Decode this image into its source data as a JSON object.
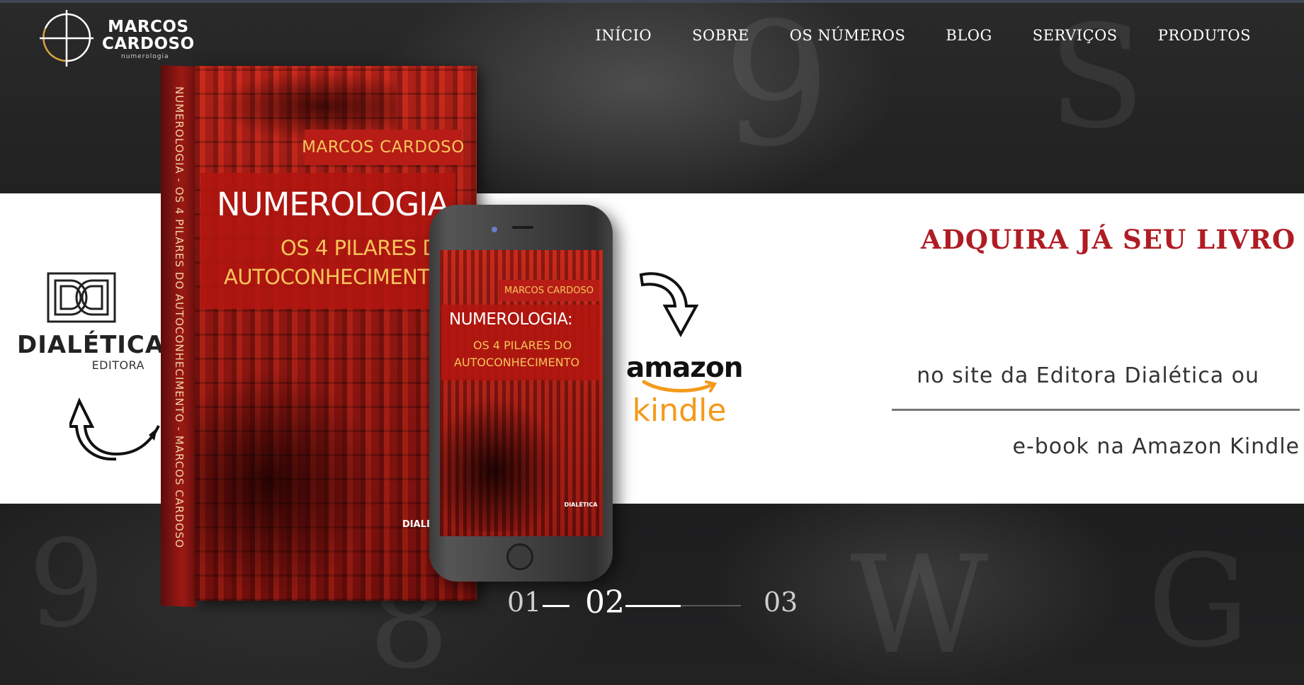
{
  "brand": {
    "name_line1": "MARCOS",
    "name_line2": "CARDOSO",
    "tagline": "numerologia"
  },
  "nav": [
    {
      "label": "INÍCIO"
    },
    {
      "label": "SOBRE"
    },
    {
      "label": "OS NÚMEROS"
    },
    {
      "label": "BLOG"
    },
    {
      "label": "SERVIÇOS"
    },
    {
      "label": "PRODUTOS"
    }
  ],
  "slide": {
    "publisher": {
      "name": "DIALÉTICA",
      "subtitle": "EDITORA"
    },
    "store": {
      "amazon": "amazon",
      "kindle": "kindle"
    },
    "book": {
      "author": "MARCOS CARDOSO",
      "title": "NUMEROLOGIA",
      "subtitle_line1": "OS 4 PILARES D",
      "subtitle_line2": "AUTOCONHECIMENT",
      "spine": "NUMEROLOGIA - OS 4 PILARES DO AUTOCONHECIMENTO - MARCOS CARDOSO",
      "publisher_mark": "DIALÉTICA"
    },
    "phone_cover": {
      "author": "MARCOS CARDOSO",
      "title": "NUMEROLOGIA:",
      "subtitle_line1": "OS 4 PILARES DO",
      "subtitle_line2": "AUTOCONHECIMENTO",
      "publisher_mark": "DIALÉTICA"
    },
    "cta": {
      "title": "ADQUIRA JÁ SEU LIVRO",
      "line1": "no site da Editora Dialética ou",
      "line2": "e-book na Amazon Kindle"
    }
  },
  "pager": {
    "items": [
      "01",
      "02",
      "03"
    ],
    "active": "02"
  },
  "colors": {
    "accent_red": "#b01c24",
    "kindle_orange": "#f39a1c",
    "logo_gold": "#d9a441"
  }
}
